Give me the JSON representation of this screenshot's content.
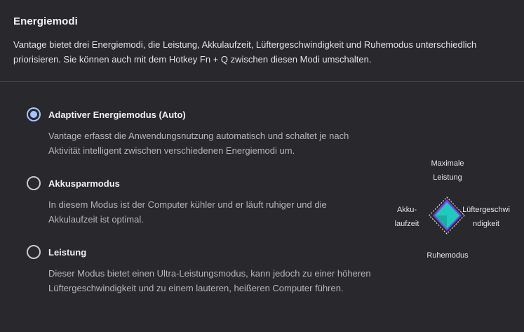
{
  "header": {
    "title": "Energiemodi",
    "description": "Vantage bietet drei Energiemodi, die Leistung, Akkulaufzeit, Lüftergeschwindigkeit und Ruhemodus unterschiedlich priorisieren. Sie können auch mit dem Hotkey Fn + Q zwischen diesen Modi umschalten."
  },
  "modes": [
    {
      "label": "Adaptiver Energiemodus (Auto)",
      "description": "Vantage erfasst die Anwendungsnutzung automatisch und schaltet je nach Aktivität intelligent zwischen verschiedenen Energiemodi um.",
      "selected": true
    },
    {
      "label": "Akkusparmodus",
      "description": "In diesem Modus ist der Computer kühler und er läuft ruhiger und die Akkulaufzeit ist optimal.",
      "selected": false
    },
    {
      "label": "Leistung",
      "description": "Dieser Modus bietet einen Ultra-Leistungsmodus, kann jedoch zu einer höheren Lüftergeschwindigkeit und zu einem lauteren, heißeren Computer führen.",
      "selected": false
    }
  ],
  "diagram": {
    "top_label": "Maximale Leistung",
    "left_label": "Akku- laufzeit",
    "right_label": "Lüftergeschwi ndigkeit",
    "bottom_label": "Ruhemodus",
    "colors": {
      "accent_purple": "#7b3fe4",
      "accent_teal": "#20c9bd",
      "outline": "#e8e8ea"
    }
  },
  "colors": {
    "background": "#28282d",
    "radio_selected": "#a8c4ff",
    "divider": "#4a4a51"
  }
}
